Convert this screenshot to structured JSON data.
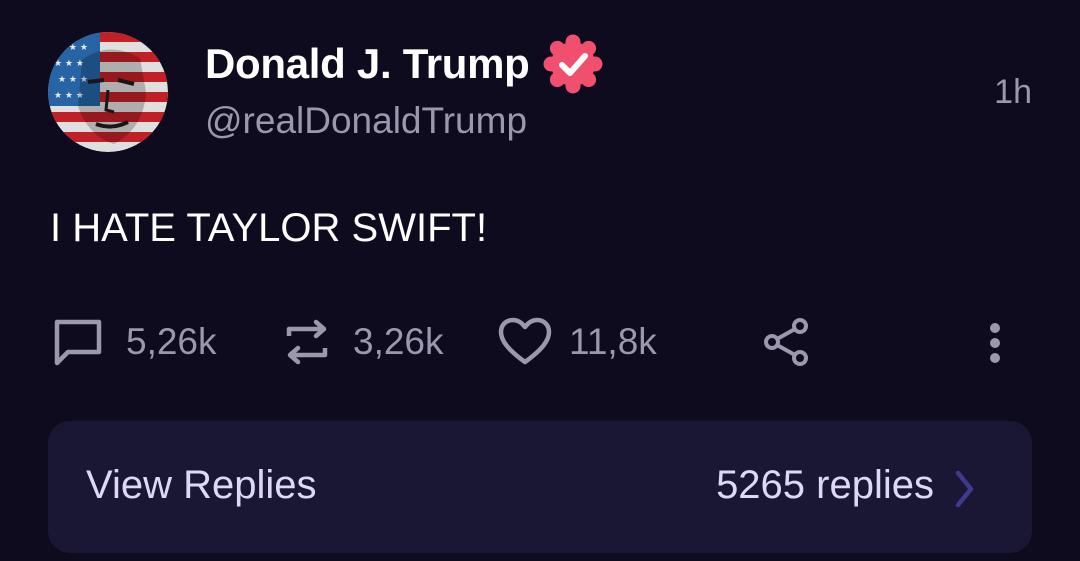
{
  "author": {
    "display_name": "Donald J. Trump",
    "handle": "@realDonaldTrump",
    "verified": true,
    "avatar_icon": "flag-portrait-avatar"
  },
  "post": {
    "time": "1h",
    "text": "I HATE TAYLOR SWIFT!"
  },
  "actions": {
    "replies": {
      "icon": "comment-icon",
      "count": "5,26k"
    },
    "reposts": {
      "icon": "repost-icon",
      "count": "3,26k"
    },
    "likes": {
      "icon": "heart-icon",
      "count": "11,8k"
    },
    "share": {
      "icon": "share-icon"
    },
    "more": {
      "icon": "more-vertical-icon"
    }
  },
  "replies_bar": {
    "label": "View Replies",
    "count_text": "5265 replies",
    "icon": "chevron-right-icon"
  },
  "colors": {
    "background": "#0e0b1f",
    "card": "#1a1735",
    "muted_text": "#9b98ad",
    "verified_badge": "#f0506e",
    "chevron": "#3e3a8f"
  }
}
